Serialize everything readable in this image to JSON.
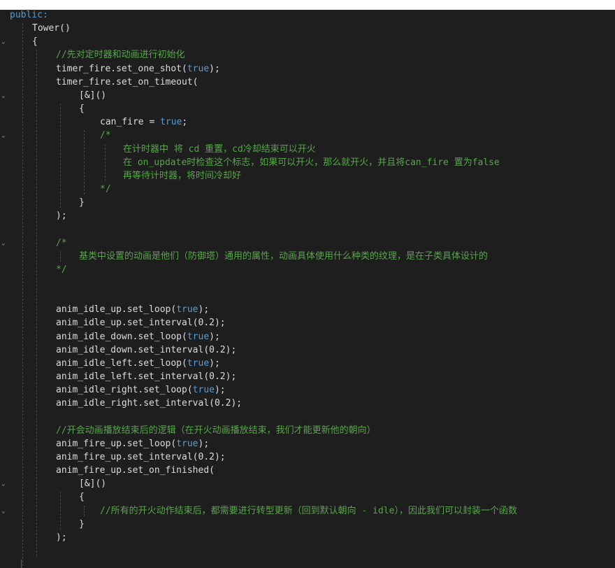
{
  "editor": {
    "code_lines": [
      {
        "indent": 0,
        "tokens": [
          {
            "t": "public:",
            "c": "kw"
          }
        ]
      },
      {
        "indent": 1,
        "tokens": [
          {
            "t": "Tower()",
            "c": "tx"
          }
        ]
      },
      {
        "indent": 1,
        "tokens": [
          {
            "t": "{",
            "c": "tx"
          }
        ]
      },
      {
        "indent": 2,
        "tokens": [
          {
            "t": "//先对定时器和动画进行初始化",
            "c": "cm"
          }
        ]
      },
      {
        "indent": 2,
        "tokens": [
          {
            "t": "timer_fire.set_one_shot(",
            "c": "tx"
          },
          {
            "t": "true",
            "c": "kw"
          },
          {
            "t": ");",
            "c": "tx"
          }
        ]
      },
      {
        "indent": 2,
        "tokens": [
          {
            "t": "timer_fire.set_on_timeout(",
            "c": "tx"
          }
        ]
      },
      {
        "indent": 3,
        "tokens": [
          {
            "t": "[&]()",
            "c": "tx"
          }
        ]
      },
      {
        "indent": 3,
        "tokens": [
          {
            "t": "{",
            "c": "tx"
          }
        ]
      },
      {
        "indent": 4,
        "tokens": [
          {
            "t": "can_fire = ",
            "c": "tx"
          },
          {
            "t": "true",
            "c": "kw"
          },
          {
            "t": ";",
            "c": "tx"
          }
        ]
      },
      {
        "indent": 4,
        "tokens": [
          {
            "t": "/*",
            "c": "cm"
          }
        ]
      },
      {
        "indent": 5,
        "tokens": [
          {
            "t": "在计时器中 将 cd 重置，cd冷却结束可以开火",
            "c": "cm"
          }
        ]
      },
      {
        "indent": 5,
        "tokens": [
          {
            "t": "在 on_update时检查这个标志，如果可以开火，那么就开火，并且将can_fire 置为false",
            "c": "cm"
          }
        ]
      },
      {
        "indent": 5,
        "tokens": [
          {
            "t": "再等待计时器，将时间冷却好",
            "c": "cm"
          }
        ]
      },
      {
        "indent": 4,
        "tokens": [
          {
            "t": "*/",
            "c": "cm"
          }
        ]
      },
      {
        "indent": 3,
        "tokens": [
          {
            "t": "}",
            "c": "tx"
          }
        ]
      },
      {
        "indent": 2,
        "tokens": [
          {
            "t": ");",
            "c": "tx"
          }
        ]
      },
      {
        "indent": 2,
        "tokens": []
      },
      {
        "indent": 2,
        "tokens": [
          {
            "t": "/*",
            "c": "cm"
          }
        ]
      },
      {
        "indent": 3,
        "tokens": [
          {
            "t": "基类中设置的动画是他们（防御塔）通用的属性，动画具体使用什么种类的纹理，是在子类具体设计的",
            "c": "cm"
          }
        ]
      },
      {
        "indent": 2,
        "tokens": [
          {
            "t": "*/",
            "c": "cm"
          }
        ]
      },
      {
        "indent": 2,
        "tokens": []
      },
      {
        "indent": 2,
        "tokens": []
      },
      {
        "indent": 2,
        "tokens": [
          {
            "t": "anim_idle_up.set_loop(",
            "c": "tx"
          },
          {
            "t": "true",
            "c": "kw"
          },
          {
            "t": ");",
            "c": "tx"
          }
        ]
      },
      {
        "indent": 2,
        "tokens": [
          {
            "t": "anim_idle_up.set_interval(0.2);",
            "c": "tx"
          }
        ]
      },
      {
        "indent": 2,
        "tokens": [
          {
            "t": "anim_idle_down.set_loop(",
            "c": "tx"
          },
          {
            "t": "true",
            "c": "kw"
          },
          {
            "t": ");",
            "c": "tx"
          }
        ]
      },
      {
        "indent": 2,
        "tokens": [
          {
            "t": "anim_idle_down.set_interval(0.2);",
            "c": "tx"
          }
        ]
      },
      {
        "indent": 2,
        "tokens": [
          {
            "t": "anim_idle_left.set_loop(",
            "c": "tx"
          },
          {
            "t": "true",
            "c": "kw"
          },
          {
            "t": ");",
            "c": "tx"
          }
        ]
      },
      {
        "indent": 2,
        "tokens": [
          {
            "t": "anim_idle_left.set_interval(0.2);",
            "c": "tx"
          }
        ]
      },
      {
        "indent": 2,
        "tokens": [
          {
            "t": "anim_idle_right.set_loop(",
            "c": "tx"
          },
          {
            "t": "true",
            "c": "kw"
          },
          {
            "t": ");",
            "c": "tx"
          }
        ]
      },
      {
        "indent": 2,
        "tokens": [
          {
            "t": "anim_idle_right.set_interval(0.2);",
            "c": "tx"
          }
        ]
      },
      {
        "indent": 2,
        "tokens": []
      },
      {
        "indent": 2,
        "tokens": [
          {
            "t": "//开会动画播放结束后的逻辑（在开火动画播放结束，我们才能更新他的朝向）",
            "c": "cm"
          }
        ]
      },
      {
        "indent": 2,
        "tokens": [
          {
            "t": "anim_fire_up.set_loop(",
            "c": "tx"
          },
          {
            "t": "true",
            "c": "kw"
          },
          {
            "t": ");",
            "c": "tx"
          }
        ]
      },
      {
        "indent": 2,
        "tokens": [
          {
            "t": "anim_fire_up.set_interval(0.2);",
            "c": "tx"
          }
        ]
      },
      {
        "indent": 2,
        "tokens": [
          {
            "t": "anim_fire_up.set_on_finished(",
            "c": "tx"
          }
        ]
      },
      {
        "indent": 3,
        "tokens": [
          {
            "t": "[&]()",
            "c": "tx"
          }
        ]
      },
      {
        "indent": 3,
        "tokens": [
          {
            "t": "{",
            "c": "tx"
          }
        ]
      },
      {
        "indent": 4,
        "tokens": [
          {
            "t": "//所有的开火动作结束后，都需要进行转型更新（回到默认朝向 - idle），因此我们可以封装一个函数",
            "c": "cm"
          }
        ]
      },
      {
        "indent": 3,
        "tokens": [
          {
            "t": "}",
            "c": "tx"
          }
        ]
      },
      {
        "indent": 2,
        "tokens": [
          {
            "t": ");",
            "c": "tx"
          }
        ]
      }
    ],
    "fold_markers": [
      "chevron-down-icon",
      "chevron-down-icon",
      "chevron-down-icon",
      "chevron-down-icon",
      "chevron-down-icon",
      "chevron-down-icon"
    ],
    "colors": {
      "background": "#1e1e1e",
      "keyword": "#569cd6",
      "comment": "#57a64a",
      "text": "#dcdcdc",
      "indent_guide": "#464646"
    }
  }
}
